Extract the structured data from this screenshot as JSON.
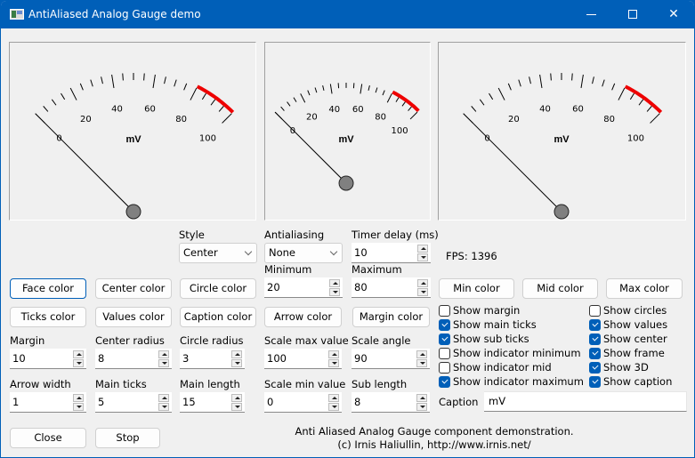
{
  "window": {
    "title": "AntiAliased Analog Gauge demo",
    "controls": {
      "minimize": "minimize",
      "maximize": "maximize",
      "close": "close"
    }
  },
  "gauges": {
    "caption": "mV",
    "scale_min": 0,
    "scale_max": 100,
    "main_labels": [
      "0",
      "20",
      "40",
      "60",
      "80",
      "100"
    ],
    "value": 0,
    "indicator_max_from": 80,
    "colors": {
      "indicator_max": "#ee0000",
      "arrow": "#000000",
      "center": "#808080",
      "ticks": "#000000"
    }
  },
  "controls": {
    "style": {
      "label": "Style",
      "value": "Center"
    },
    "antialiasing": {
      "label": "Antialiasing",
      "value": "None"
    },
    "timer_delay": {
      "label": "Timer delay (ms)",
      "value": "10"
    },
    "fps": "FPS: 1396",
    "minimum": {
      "label": "Minimum",
      "value": "20"
    },
    "maximum": {
      "label": "Maximum",
      "value": "80"
    },
    "margin": {
      "label": "Margin",
      "value": "10"
    },
    "center_radius": {
      "label": "Center radius",
      "value": "8"
    },
    "circle_radius": {
      "label": "Circle radius",
      "value": "3"
    },
    "scale_max_value": {
      "label": "Scale max value",
      "value": "100"
    },
    "scale_angle": {
      "label": "Scale angle",
      "value": "90"
    },
    "arrow_width": {
      "label": "Arrow width",
      "value": "1"
    },
    "main_ticks": {
      "label": "Main ticks",
      "value": "5"
    },
    "main_length": {
      "label": "Main length",
      "value": "15"
    },
    "scale_min_value": {
      "label": "Scale min value",
      "value": "0"
    },
    "sub_length": {
      "label": "Sub length",
      "value": "8"
    },
    "caption": {
      "label": "Caption",
      "value": "mV"
    }
  },
  "buttons": {
    "face_color": "Face color",
    "center_color": "Center color",
    "circle_color": "Circle color",
    "ticks_color": "Ticks color",
    "values_color": "Values color",
    "caption_color": "Caption color",
    "arrow_color": "Arrow color",
    "margin_color": "Margin color",
    "min_color": "Min color",
    "mid_color": "Mid color",
    "max_color": "Max color",
    "close": "Close",
    "stop": "Stop"
  },
  "checkboxes": [
    {
      "label": "Show margin",
      "checked": false
    },
    {
      "label": "Show main ticks",
      "checked": true
    },
    {
      "label": "Show sub ticks",
      "checked": true
    },
    {
      "label": "Show indicator minimum",
      "checked": false
    },
    {
      "label": "Show indicator mid",
      "checked": false
    },
    {
      "label": "Show indicator maximum",
      "checked": true
    },
    {
      "label": "Show circles",
      "checked": false
    },
    {
      "label": "Show values",
      "checked": true
    },
    {
      "label": "Show center",
      "checked": true
    },
    {
      "label": "Show frame",
      "checked": true
    },
    {
      "label": "Show 3D",
      "checked": true
    },
    {
      "label": "Show caption",
      "checked": true
    }
  ],
  "footer": {
    "line1": "Anti Aliased Analog Gauge component demonstration.",
    "line2": "(c) Irnis Haliullin, http://www.irnis.net/"
  }
}
